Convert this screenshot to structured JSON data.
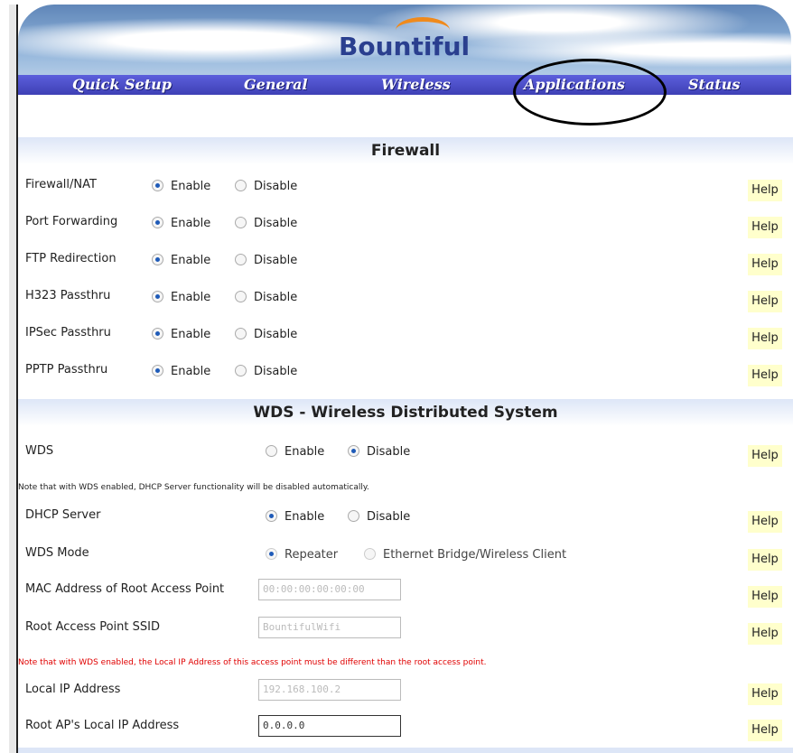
{
  "brand": {
    "logo_text": "Bountiful"
  },
  "nav": {
    "items": [
      {
        "label": "Quick Setup"
      },
      {
        "label": "General"
      },
      {
        "label": "Wireless"
      },
      {
        "label": "Applications"
      },
      {
        "label": "Status"
      }
    ],
    "highlighted": "Applications"
  },
  "firewall": {
    "title": "Firewall",
    "rows": [
      {
        "label": "Firewall/NAT",
        "enable": "Enable",
        "disable": "Disable",
        "selected": "Enable",
        "help": "Help"
      },
      {
        "label": "Port Forwarding",
        "enable": "Enable",
        "disable": "Disable",
        "selected": "Enable",
        "help": "Help"
      },
      {
        "label": "FTP Redirection",
        "enable": "Enable",
        "disable": "Disable",
        "selected": "Enable",
        "help": "Help"
      },
      {
        "label": "H323 Passthru",
        "enable": "Enable",
        "disable": "Disable",
        "selected": "Enable",
        "help": "Help"
      },
      {
        "label": "IPSec Passthru",
        "enable": "Enable",
        "disable": "Disable",
        "selected": "Enable",
        "help": "Help"
      },
      {
        "label": "PPTP Passthru",
        "enable": "Enable",
        "disable": "Disable",
        "selected": "Enable",
        "help": "Help"
      }
    ]
  },
  "wds": {
    "title": "WDS - Wireless Distributed System",
    "wds_row": {
      "label": "WDS",
      "enable": "Enable",
      "disable": "Disable",
      "selected": "Disable",
      "help": "Help"
    },
    "note1": "Note that with WDS enabled, DHCP Server functionality will be disabled automatically.",
    "dhcp_row": {
      "label": "DHCP Server",
      "enable": "Enable",
      "disable": "Disable",
      "selected": "Enable",
      "help": "Help"
    },
    "mode_row": {
      "label": "WDS Mode",
      "opt1": "Repeater",
      "opt2": "Ethernet Bridge/Wireless Client",
      "selected": "Repeater",
      "help": "Help"
    },
    "mac_row": {
      "label": "MAC Address of Root Access Point",
      "value": "00:00:00:00:00:00",
      "help": "Help"
    },
    "ssid_row": {
      "label": "Root Access Point SSID",
      "value": "BountifulWifi",
      "help": "Help"
    },
    "note2": "Note that with WDS enabled, the Local IP Address of this access point must be different than the root access point.",
    "localip_row": {
      "label": "Local IP Address",
      "value": "192.168.100.2",
      "help": "Help"
    },
    "rootip_row": {
      "label": "Root AP's Local IP Address",
      "value": "0.0.0.0",
      "help": "Help"
    }
  },
  "colors": {
    "nav_bg": "#4a4dc8",
    "help_bg": "#ffffcc",
    "note_red": "#e00000",
    "radio_on": "#1f5bb8"
  }
}
